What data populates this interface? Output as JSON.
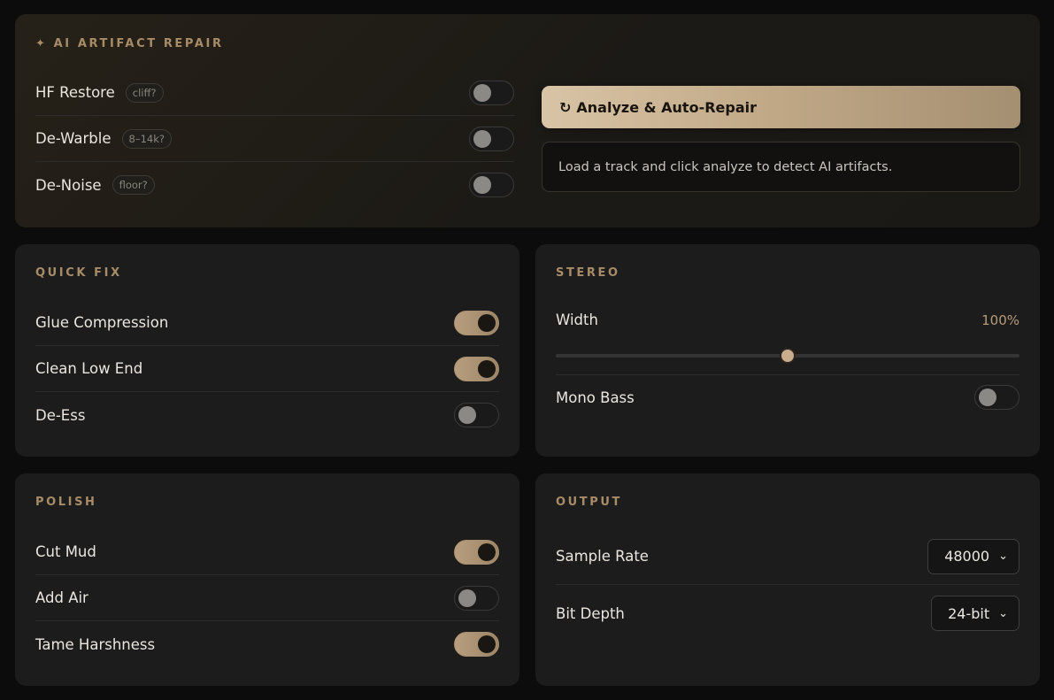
{
  "ai_repair": {
    "title": "✦ AI ARTIFACT REPAIR",
    "rows": [
      {
        "label": "HF Restore",
        "tag": "cliff?",
        "on": false
      },
      {
        "label": "De-Warble",
        "tag": "8–14k?",
        "on": false
      },
      {
        "label": "De-Noise",
        "tag": "floor?",
        "on": false
      }
    ],
    "analyze_icon": "refresh-icon",
    "analyze_glyph": "↻",
    "analyze_label": "Analyze & Auto-Repair",
    "status": "Load a track and click analyze to detect AI artifacts."
  },
  "quick_fix": {
    "title": "QUICK FIX",
    "rows": [
      {
        "label": "Glue Compression",
        "on": true
      },
      {
        "label": "Clean Low End",
        "on": true
      },
      {
        "label": "De-Ess",
        "on": false
      }
    ]
  },
  "stereo": {
    "title": "STEREO",
    "width_label": "Width",
    "width_value": "100%",
    "width_fraction": 0.5,
    "mono_bass_label": "Mono Bass",
    "mono_bass_on": false
  },
  "polish": {
    "title": "POLISH",
    "rows": [
      {
        "label": "Cut Mud",
        "on": true
      },
      {
        "label": "Add Air",
        "on": false
      },
      {
        "label": "Tame Harshness",
        "on": true
      }
    ]
  },
  "output": {
    "title": "OUTPUT",
    "sample_rate_label": "Sample Rate",
    "sample_rate_value": "48000",
    "bit_depth_label": "Bit Depth",
    "bit_depth_value": "24-bit"
  },
  "colors": {
    "accent": "#b89e7f",
    "panel": "#1c1c1c",
    "background": "#0c0c0c"
  }
}
